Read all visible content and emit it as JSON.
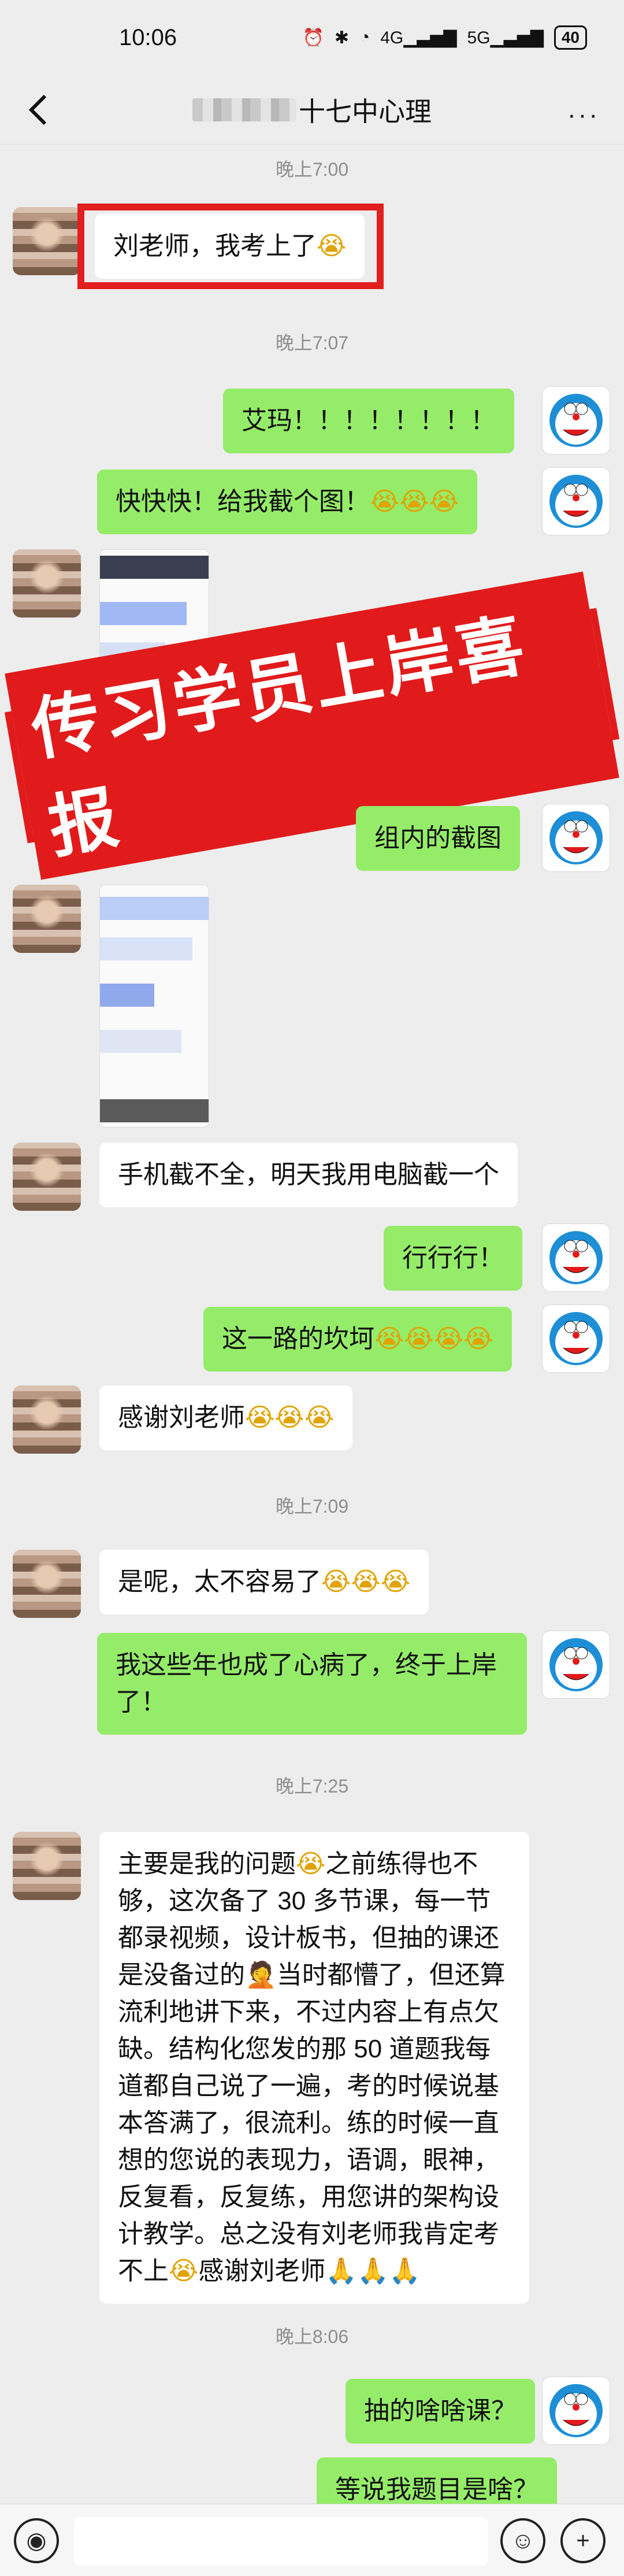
{
  "status_bar": {
    "time": "10:06",
    "battery": "40",
    "signal_a": "4G",
    "signal_b": "5G"
  },
  "nav": {
    "title": "十七中心理",
    "more": "···"
  },
  "banner": {
    "text": "传习学员上岸喜报"
  },
  "emoji": {
    "cry": "😭",
    "pray": "🙏",
    "facepalm": "🤦"
  },
  "messages": [
    {
      "kind": "time",
      "text": "晚上7:00"
    },
    {
      "kind": "left",
      "text": "刘老师，我考上了"
    },
    {
      "kind": "time",
      "text": "晚上7:07"
    },
    {
      "kind": "right",
      "text": "艾玛！！！！！！！！"
    },
    {
      "kind": "right",
      "text": "快快快！给我截个图！"
    },
    {
      "kind": "right",
      "text": "组内的截图"
    },
    {
      "kind": "left",
      "text": "手机截不全，明天我用电脑截一个"
    },
    {
      "kind": "right",
      "text": "行行行！"
    },
    {
      "kind": "right",
      "text": "这一路的坎坷"
    },
    {
      "kind": "left",
      "text": "感谢刘老师"
    },
    {
      "kind": "time",
      "text": "晚上7:09"
    },
    {
      "kind": "left",
      "text": "是呢，太不容易了"
    },
    {
      "kind": "right",
      "text": "我这些年也成了心病了，终于上岸了！"
    },
    {
      "kind": "time",
      "text": "晚上7:25"
    },
    {
      "kind": "left",
      "text": "主要是我的问题"
    },
    {
      "kind": "left",
      "text": "之前练得也不够，这次备了 30 多节课，每一节都录视频，设计板书，但抽的课还是没备过的"
    },
    {
      "kind": "left",
      "text": "当时都懵了，但还算流利地讲下来，不过内容上有点欠缺。结构化您发的那 50 道题我每道都自己说了一遍，考的时候说基本答满了，很流利。练的时候一直想的您说的表现力，语调，眼神，反复看，反复练，用您讲的架构设计教学。总之没有刘老师我肯定考不上"
    },
    {
      "kind": "left",
      "text": "感谢刘老师"
    },
    {
      "kind": "time",
      "text": "晚上8:06"
    },
    {
      "kind": "right",
      "text": "抽的啥啥课？"
    },
    {
      "kind": "right",
      "text": "等说我题目是啥？"
    }
  ]
}
